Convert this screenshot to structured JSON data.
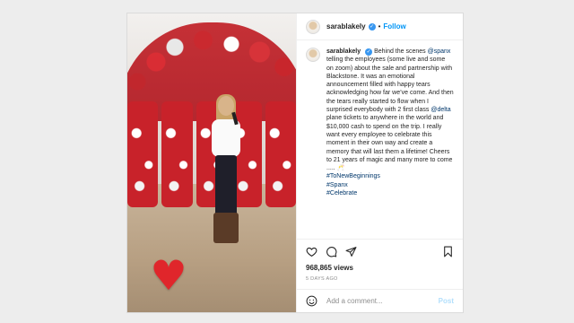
{
  "post": {
    "username": "sarablakely",
    "verified_icon": "verified-badge-icon",
    "follow_label": "Follow",
    "caption": {
      "text_1": "Behind the scenes",
      "mention_spanx": "@spanx",
      "text_2": "telling the employees (some live and some on zoom) about the sale and partnership with Blackstone. It was an emotional announcement filled with happy tears acknowledging how far we’ve come. And then the tears really started to flow when I surprised everybody with 2 first class",
      "mention_delta": "@delta",
      "text_3": "plane tickets to anywhere in the world and $10,000 cash to spend on the trip. I really want every employee to celebrate this moment in their own way and create a memory that will last them a lifetime! Cheers to 21 years of magic and many more to come ..... 🥂",
      "hashtags": [
        "#ToNewBeginnings",
        "#Spanx",
        "#Celebrate"
      ]
    },
    "views": "968,865 views",
    "date": "5 DAYS AGO",
    "comment_placeholder": "Add a comment...",
    "post_label": "Post",
    "accent_color": "#0095f6",
    "heart_color": "#e0262b"
  }
}
